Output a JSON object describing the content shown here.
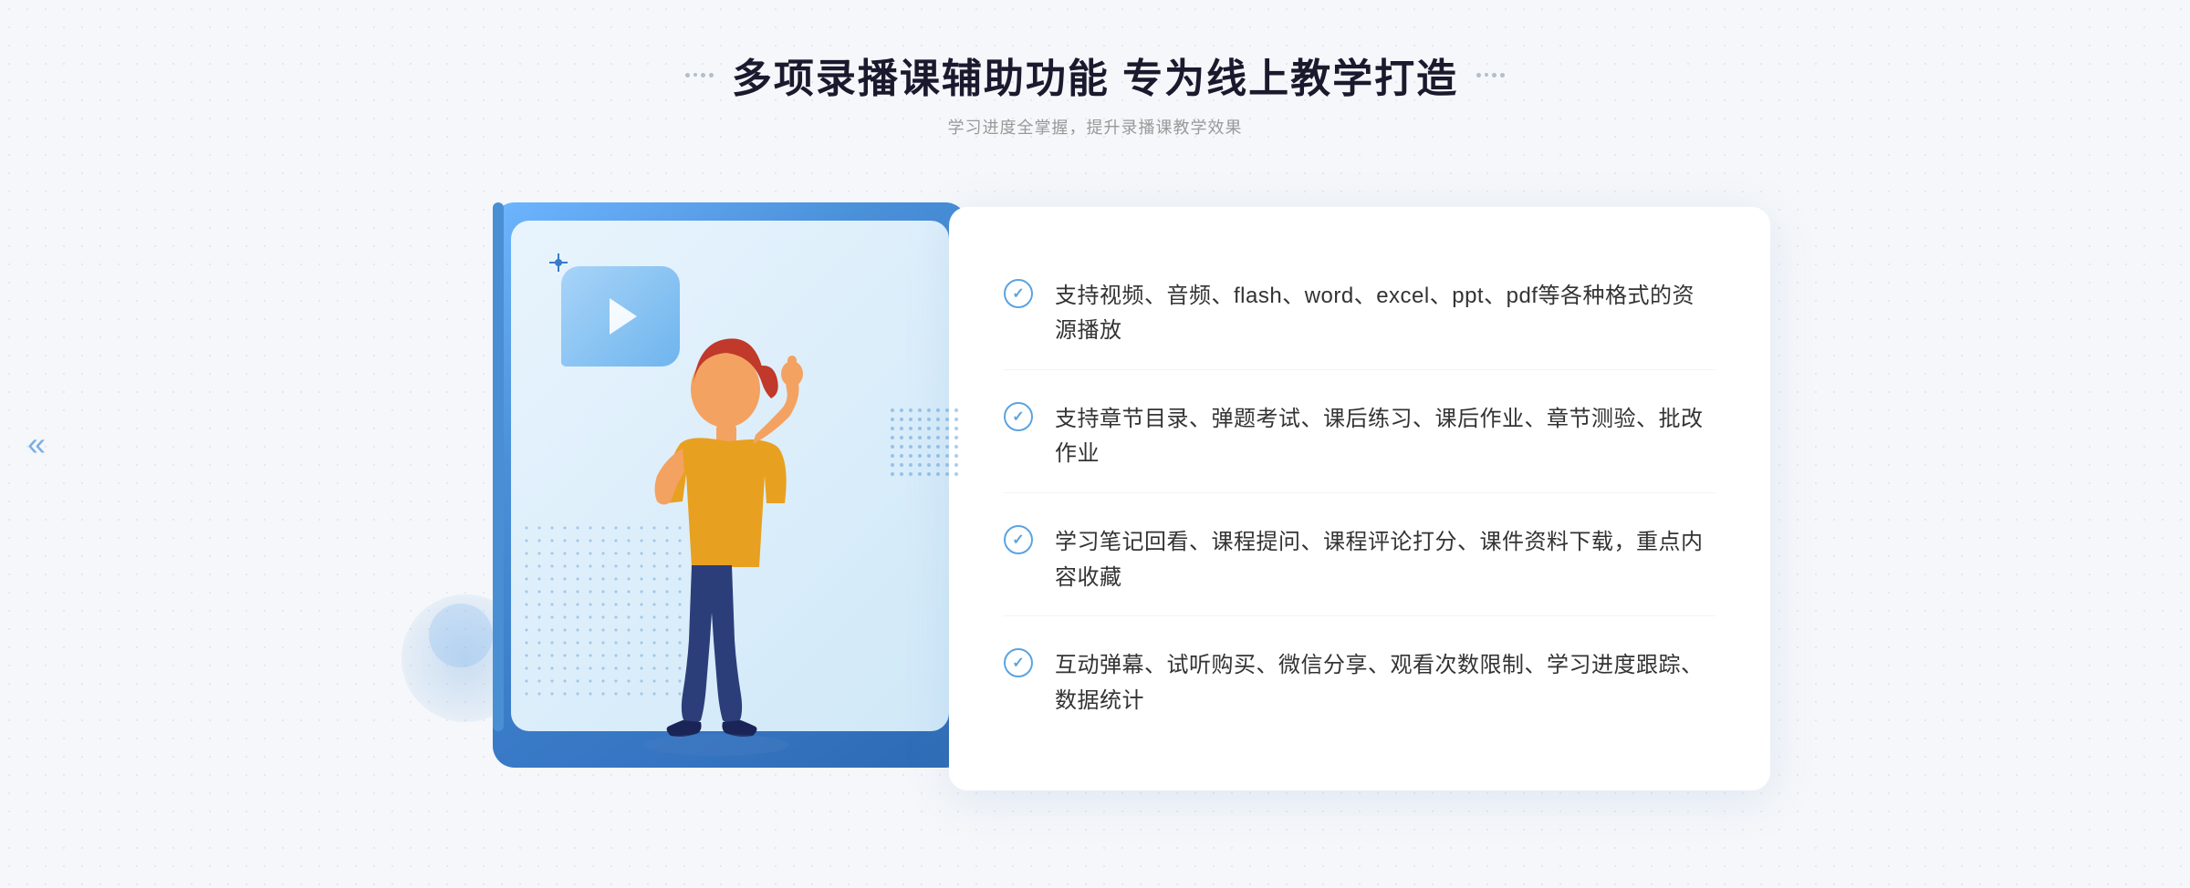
{
  "page": {
    "background_dots": true
  },
  "header": {
    "main_title": "多项录播课辅助功能 专为线上教学打造",
    "sub_title": "学习进度全掌握，提升录播课教学效果",
    "left_decorator": "❋",
    "right_decorator": "❋"
  },
  "features": [
    {
      "id": 1,
      "text": "支持视频、音频、flash、word、excel、ppt、pdf等各种格式的资源播放"
    },
    {
      "id": 2,
      "text": "支持章节目录、弹题考试、课后练习、课后作业、章节测验、批改作业"
    },
    {
      "id": 3,
      "text": "学习笔记回看、课程提问、课程评论打分、课件资料下载，重点内容收藏"
    },
    {
      "id": 4,
      "text": "互动弹幕、试听购买、微信分享、观看次数限制、学习进度跟踪、数据统计"
    }
  ],
  "icons": {
    "check": "✓",
    "play": "▶",
    "left_arrow": "«",
    "sparkle": "✦"
  },
  "colors": {
    "primary_blue": "#4a90d9",
    "light_blue": "#6eb5ee",
    "dark_blue": "#2e6ab5",
    "text_dark": "#333333",
    "text_gray": "#999999",
    "white": "#ffffff",
    "bg_gray": "#f5f7fa"
  }
}
